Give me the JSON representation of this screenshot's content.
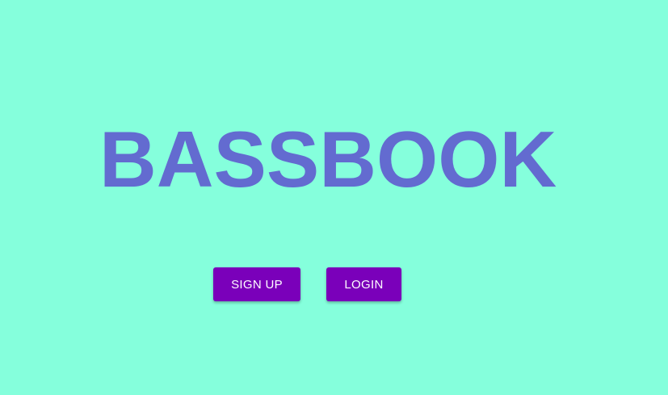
{
  "brand": {
    "title": "BASSBOOK",
    "title_color": "#636bd0"
  },
  "actions": {
    "signup_label": "SIGN UP",
    "login_label": "LOGIN",
    "button_color": "#7a00ba"
  },
  "theme": {
    "background": "#85ffdc"
  }
}
